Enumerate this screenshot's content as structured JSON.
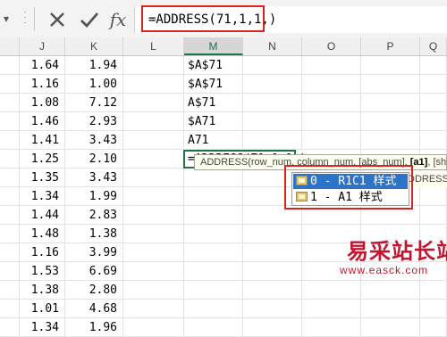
{
  "formula_bar": {
    "dropdown_glyph": "▾",
    "formula": "=ADDRESS(71,1,1,)"
  },
  "columns": [
    {
      "label": "J"
    },
    {
      "label": "K"
    },
    {
      "label": "L"
    },
    {
      "label": "M"
    },
    {
      "label": "N"
    },
    {
      "label": "O"
    },
    {
      "label": "P"
    },
    {
      "label": "Q"
    }
  ],
  "rows": [
    {
      "j": "1.64",
      "k": "1.94",
      "m": "$A$71"
    },
    {
      "j": "1.16",
      "k": "1.00",
      "m": "$A$71"
    },
    {
      "j": "1.08",
      "k": "7.12",
      "m": "A$71"
    },
    {
      "j": "1.46",
      "k": "2.93",
      "m": "$A71"
    },
    {
      "j": "1.41",
      "k": "3.43",
      "m": "A71"
    },
    {
      "j": "1.25",
      "k": "2.10",
      "m": "=ADDRESS(71,1,1,)"
    },
    {
      "j": "1.35",
      "k": "3.43",
      "m": ""
    },
    {
      "j": "1.34",
      "k": "1.99",
      "m": ""
    },
    {
      "j": "1.44",
      "k": "2.83",
      "m": ""
    },
    {
      "j": "1.48",
      "k": "1.38",
      "m": ""
    },
    {
      "j": "1.16",
      "k": "3.99",
      "m": ""
    },
    {
      "j": "1.53",
      "k": "6.69",
      "m": ""
    },
    {
      "j": "1.38",
      "k": "2.80",
      "m": ""
    },
    {
      "j": "1.01",
      "k": "4.68",
      "m": ""
    },
    {
      "j": "1.34",
      "k": "1.96",
      "m": ""
    }
  ],
  "tooltip": {
    "prefix": "ADDRESS(row_num, column_num, [abs_num], ",
    "bold": "[a1]",
    "suffix": ", [sheet_text])"
  },
  "dropdown": {
    "options": [
      {
        "label": "0 - R1C1 样式",
        "selected": true
      },
      {
        "label": "1 - A1 样式",
        "selected": false
      }
    ],
    "overflow_text": "DDRESS 返回"
  },
  "watermark": {
    "title": "易采站长站",
    "url": "www.easck.com"
  },
  "colors": {
    "highlight_red": "#d9231f",
    "excel_green": "#217346",
    "selection_blue": "#2b74c7",
    "watermark_red": "#c3152f"
  },
  "icons": {
    "cancel": "close-icon",
    "enter": "checkmark-icon",
    "function": "fx-icon"
  }
}
